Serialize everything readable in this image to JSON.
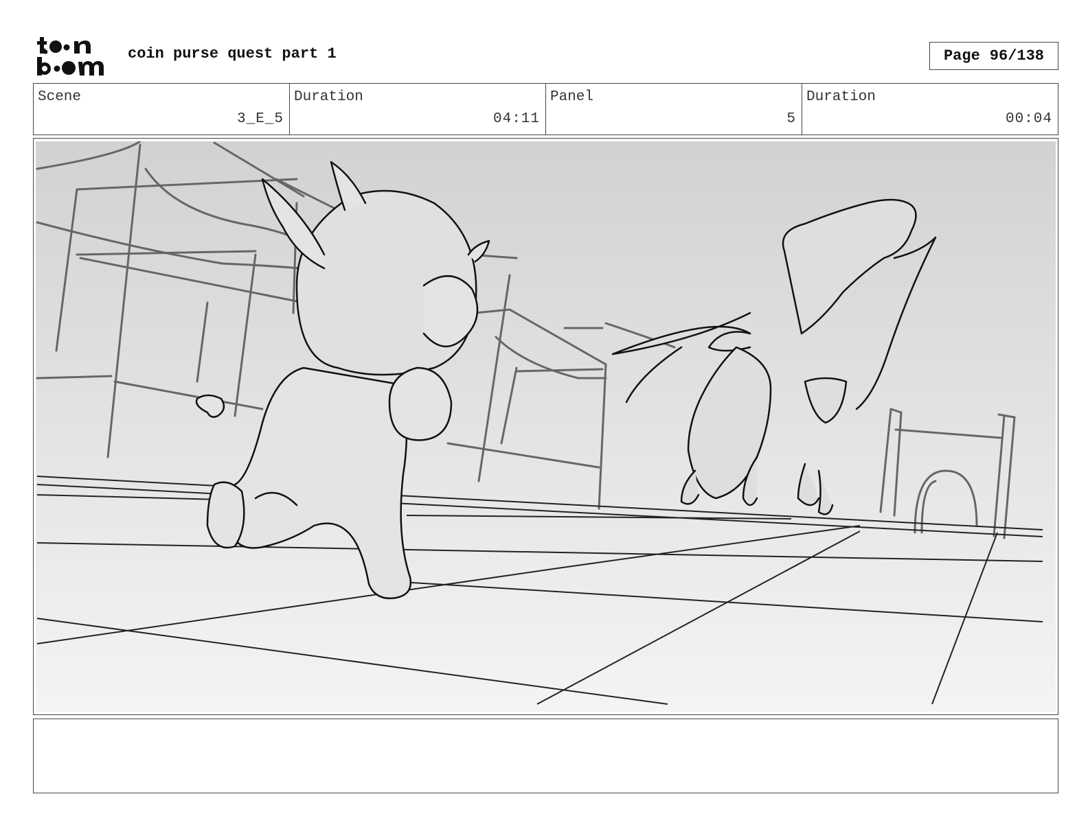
{
  "header": {
    "logo_alt": "toon boom",
    "title": "coin purse quest part 1",
    "page_label": "Page",
    "page_value": "96/138"
  },
  "info": {
    "scene_label": "Scene",
    "scene_value": "3_E_5",
    "scene_duration_label": "Duration",
    "scene_duration_value": "04:11",
    "panel_label": "Panel",
    "panel_value": "5",
    "panel_duration_label": "Duration",
    "panel_duration_value": "00:04"
  },
  "panel": {
    "sketch_tone_top": "#d2d2d2",
    "sketch_tone_bottom": "#f4f4f4",
    "line_color": "#111111",
    "bg_line_color": "#666666"
  },
  "notes": {
    "text": ""
  }
}
